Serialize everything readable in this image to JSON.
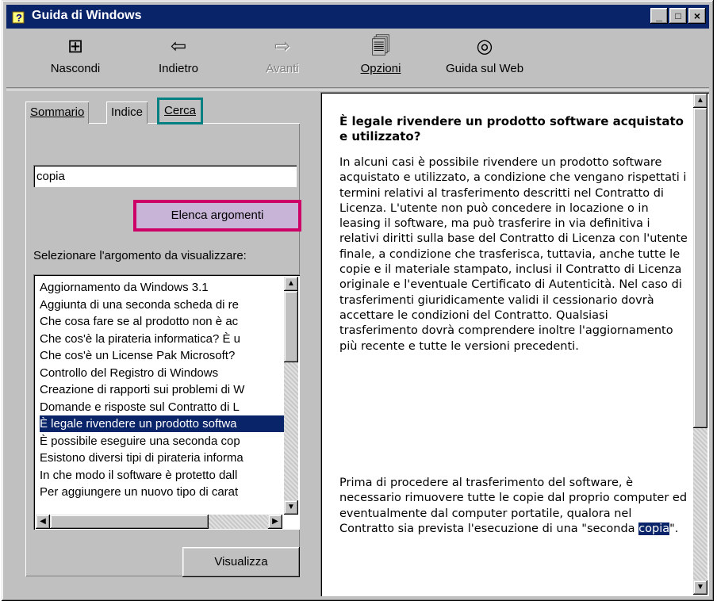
{
  "window": {
    "title": "Guida di Windows",
    "minimize": "_",
    "maximize": "□",
    "close": "×"
  },
  "toolbar": {
    "nascondi": {
      "label": "Nascondi",
      "icon": "hide-icon"
    },
    "indietro": {
      "label": "Indietro",
      "icon": "back-arrow-icon"
    },
    "avanti": {
      "label": "Avanti",
      "icon": "forward-arrow-icon"
    },
    "opzioni": {
      "label": "Opzioni",
      "icon": "options-icon"
    },
    "web": {
      "label": "Guida sul Web",
      "icon": "web-help-icon"
    }
  },
  "tabs": {
    "sommario": "Sommario",
    "indice": "Indice",
    "cerca": "Cerca"
  },
  "search": {
    "value": "copia",
    "list_button": "Elenca argomenti",
    "select_label": "Selezionare l'argomento da visualizzare:"
  },
  "topics": [
    "Aggiornamento da Windows 3.1",
    "Aggiunta di una seconda scheda di re",
    "Che cosa fare se al prodotto non è ac",
    "Che cos'è la pirateria informatica? È u",
    "Che cos'è un License Pak Microsoft?",
    "Controllo del Registro di Windows",
    "Creazione di rapporti sui problemi di W",
    "Domande e risposte sul Contratto di L",
    "È legale rivendere un prodotto softwa",
    "È possibile eseguire una seconda cop",
    "Esistono diversi tipi di pirateria informa",
    "In che modo il software è protetto dall",
    "Per aggiungere un nuovo tipo di carat"
  ],
  "selected_topic_index": 8,
  "view_button": "Visualizza",
  "article": {
    "title": "È legale rivendere un prodotto software acquistato e utilizzato?",
    "para1": "In alcuni casi è possibile rivendere un prodotto software acquistato e utilizzato, a condizione che vengano rispettati i termini relativi al trasferimento descritti nel Contratto di Licenza. L'utente non può concedere in locazione o in leasing il software, ma può trasferire in via definitiva i relativi diritti sulla base del Contratto di Licenza con l'utente finale, a condizione che trasferisca, tuttavia, anche tutte le copie e il materiale stampato, inclusi il Contratto di Licenza originale e l'eventuale Certificato di Autenticità. Nel caso di trasferimenti giuridicamente validi il cessionario dovrà accettare le condizioni del Contratto. Qualsiasi trasferimento dovrà comprendere inoltre l'aggiornamento più recente e tutte le versioni precedenti.",
    "para2_before": "Prima di procedere al trasferimento del software, è necessario rimuovere tutte le copie dal proprio computer ed eventualmente dal computer portatile, qualora nel Contratto sia prevista l'esecuzione di una \"seconda ",
    "para2_highlight": "copia",
    "para2_after": "\"."
  },
  "colors": {
    "titlebar": "#0a246a",
    "highlight": "#0a246a",
    "cerca_outline": "#008080",
    "button_outline": "#cc0066",
    "button_fill": "#c8b4d6"
  }
}
